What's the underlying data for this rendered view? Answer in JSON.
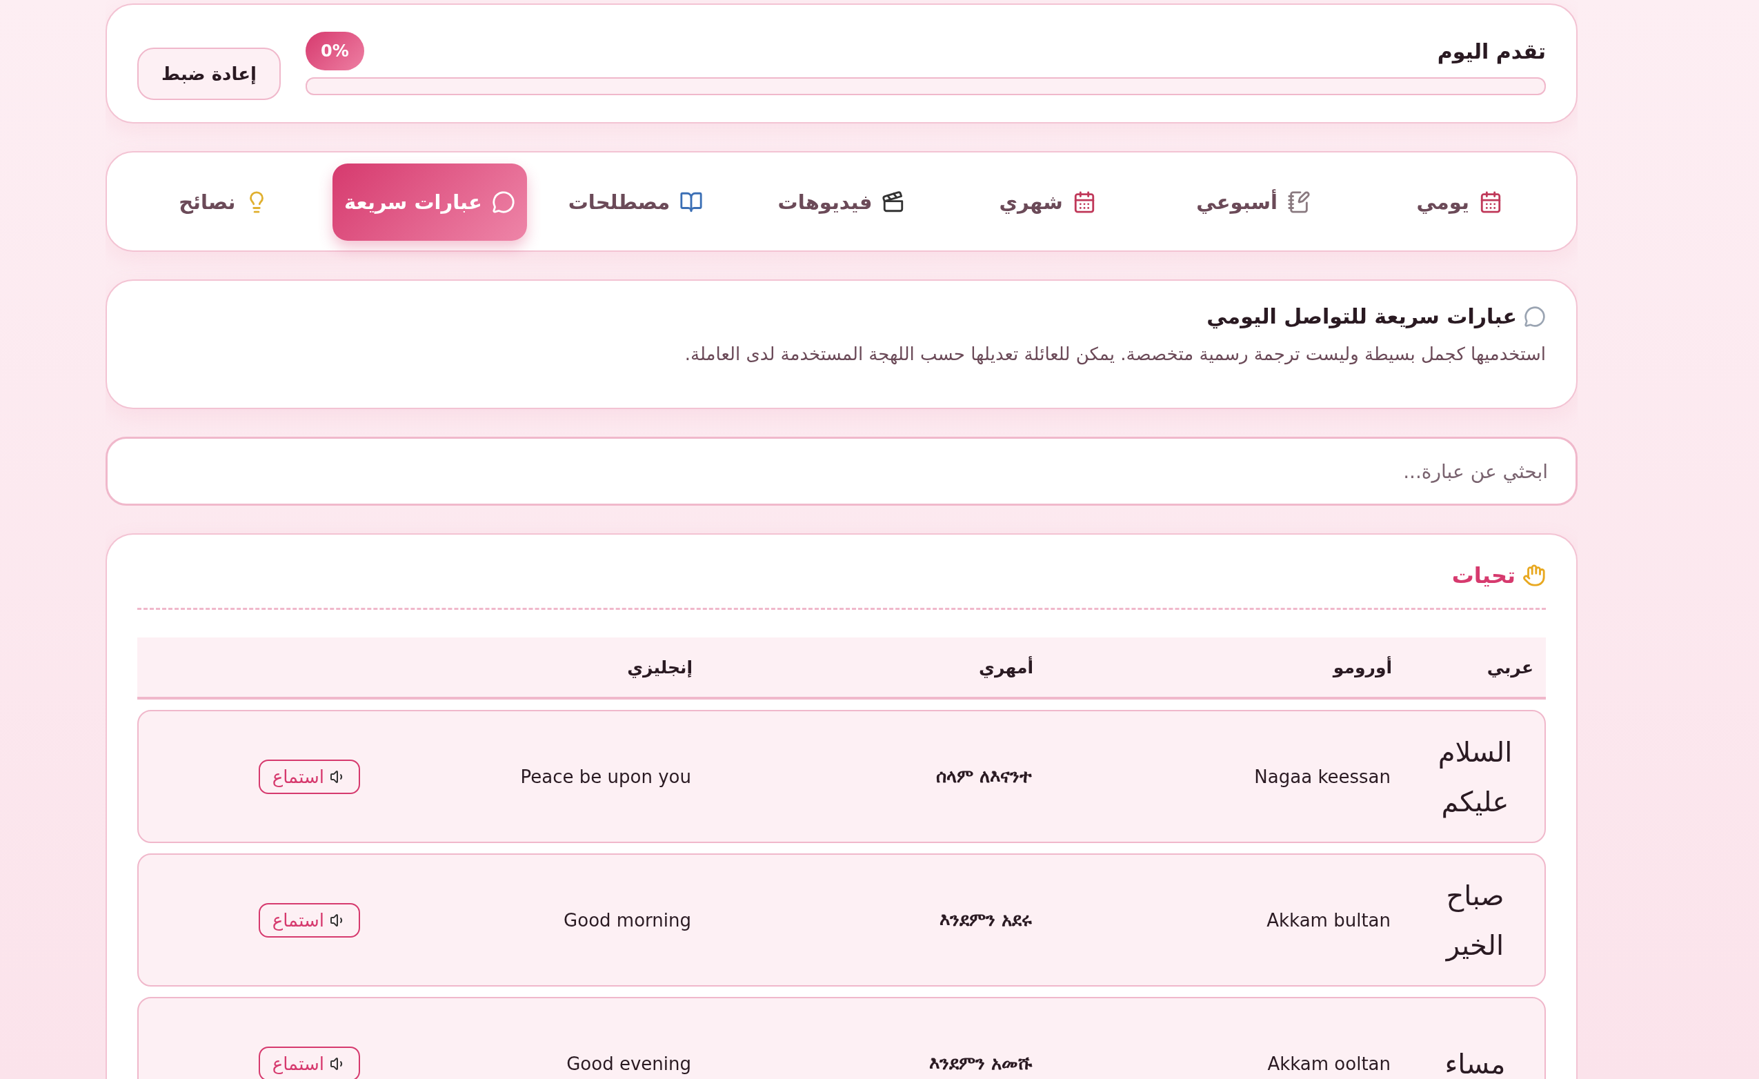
{
  "progress": {
    "title": "تقدم اليوم",
    "badge": "0%",
    "level": 0,
    "reset_button": "إعادة ضبط"
  },
  "tabs": [
    {
      "kind": "calendar",
      "label": "يومي",
      "selected": false
    },
    {
      "kind": "notepad",
      "label": "أسبوعي",
      "selected": false
    },
    {
      "kind": "calendar",
      "label": "شهري",
      "selected": false
    },
    {
      "kind": "clapper",
      "label": "فيديوهات",
      "selected": false
    },
    {
      "kind": "book",
      "label": "مصطلحات",
      "selected": false
    },
    {
      "kind": "chat",
      "label": "عبارات سريعة",
      "selected": true
    },
    {
      "kind": "bulb",
      "label": "نصائح",
      "selected": false
    }
  ],
  "intro": {
    "title": "عبارات سريعة للتواصل اليومي",
    "description": "استخدميها كجمل بسيطة وليست ترجمة رسمية متخصصة. يمكن للعائلة تعديلها حسب اللهجة المستخدمة لدى العاملة."
  },
  "search": {
    "placeholder": "ابحثي عن عبارة..."
  },
  "section": {
    "title": "تحيات",
    "table": {
      "columns": [
        "عربي",
        "أورومو",
        "أمهري",
        "إنجليزي"
      ],
      "rows": [
        {
          "arabic": "السلام عليكم",
          "oromo": "Nagaa keessan",
          "amharic": "ሰላም ለእናንተ",
          "english": "Peace be upon you",
          "button": "استماع"
        },
        {
          "arabic": "صباح الخير",
          "oromo": "Akkam bultan",
          "amharic": "እንደምን አደሩ",
          "english": "Good morning",
          "button": "استماع"
        },
        {
          "arabic": "مساء",
          "oromo": "Akkam ooltan",
          "amharic": "እንደምን አመሹ",
          "english": "Good evening",
          "button": "استماع"
        }
      ]
    }
  }
}
